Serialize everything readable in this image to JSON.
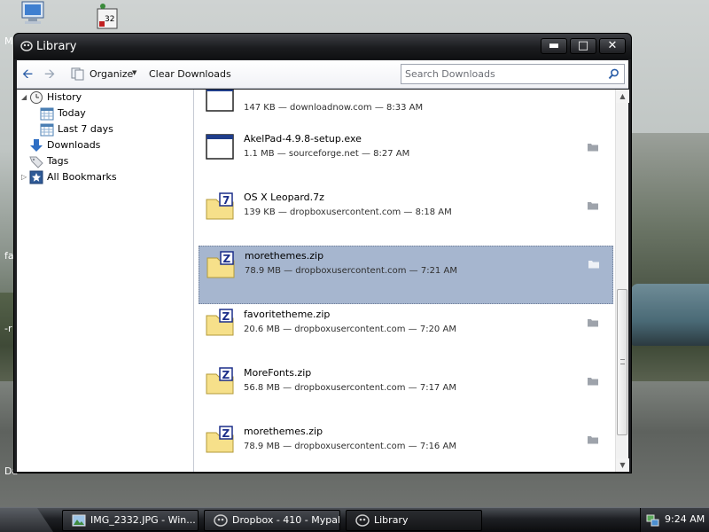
{
  "window": {
    "title": "Library"
  },
  "toolbar": {
    "organize_label": "Organize",
    "clear_downloads_label": "Clear Downloads",
    "search_placeholder": "Search Downloads"
  },
  "sidebar": {
    "items": [
      {
        "label": "History",
        "icon": "clock-icon",
        "expanded": true
      },
      {
        "label": "Today",
        "icon": "calendar-icon"
      },
      {
        "label": "Last 7 days",
        "icon": "calendar-icon"
      },
      {
        "label": "Downloads",
        "icon": "download-arrow-icon"
      },
      {
        "label": "Tags",
        "icon": "tag-icon"
      },
      {
        "label": "All Bookmarks",
        "icon": "star-icon",
        "expanded": false
      }
    ]
  },
  "downloads": [
    {
      "name": "",
      "meta": "147 KB — downloadnow.com — 8:33 AM",
      "icon": "window-file-icon"
    },
    {
      "name": "AkelPad-4.9.8-setup.exe",
      "meta": "1.1 MB — sourceforge.net — 8:27 AM",
      "icon": "window-file-icon"
    },
    {
      "name": "OS X Leopard.7z",
      "meta": "139 KB — dropboxusercontent.com — 8:18 AM",
      "icon": "7z-archive-icon"
    },
    {
      "name": "morethemes.zip",
      "meta": "78.9 MB — dropboxusercontent.com — 7:21 AM",
      "icon": "zip-archive-icon",
      "selected": true
    },
    {
      "name": "favoritetheme.zip",
      "meta": "20.6 MB — dropboxusercontent.com — 7:20 AM",
      "icon": "zip-archive-icon"
    },
    {
      "name": "MoreFonts.zip",
      "meta": "56.8 MB — dropboxusercontent.com — 7:17 AM",
      "icon": "zip-archive-icon"
    },
    {
      "name": "morethemes.zip",
      "meta": "78.9 MB — dropboxusercontent.com — 7:16 AM",
      "icon": "zip-archive-icon"
    }
  ],
  "taskbar": {
    "tasks": [
      {
        "label": "IMG_2332.JPG - Win...",
        "icon": "image-viewer-icon"
      },
      {
        "label": "Dropbox - 410 - Mypal",
        "icon": "mypal-icon"
      },
      {
        "label": "Library",
        "icon": "mypal-icon",
        "active": true
      }
    ],
    "clock": "9:24 AM"
  },
  "desktop": {
    "labels": [
      "M",
      "fa",
      "-r",
      "Da"
    ]
  },
  "colors": {
    "selection": "#a6b6cf",
    "titlebar": "#1b1c1f",
    "link_blue": "#2b5ea8"
  }
}
